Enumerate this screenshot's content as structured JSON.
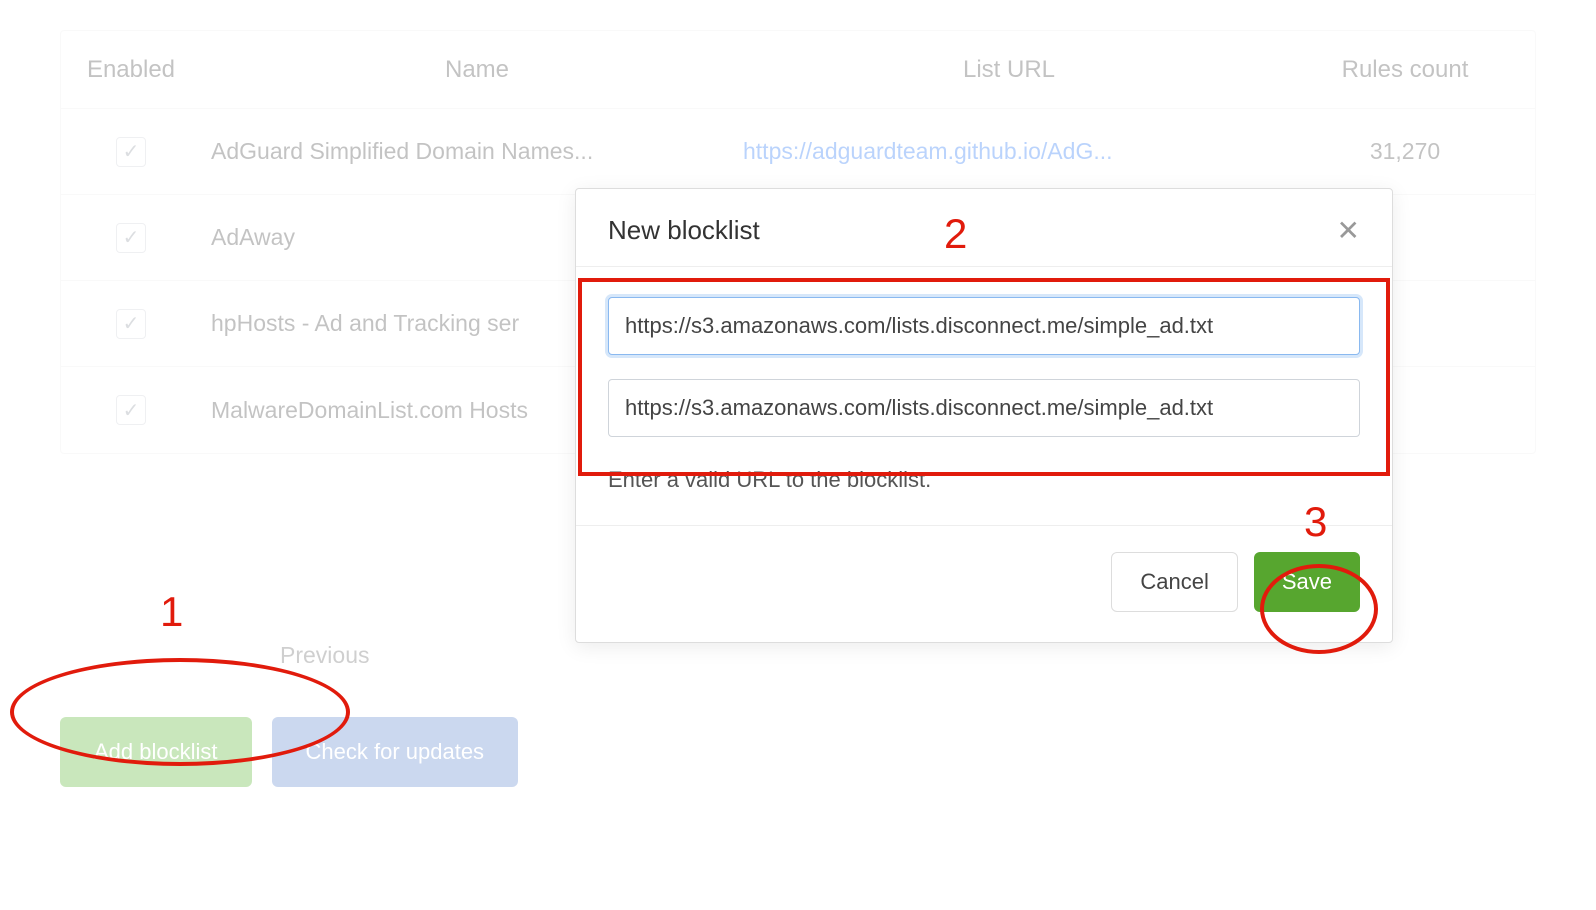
{
  "table": {
    "headers": {
      "enabled": "Enabled",
      "name": "Name",
      "url": "List URL",
      "rules": "Rules count"
    },
    "rows": [
      {
        "name": "AdGuard Simplified Domain Names...",
        "url": "https://adguardteam.github.io/AdG...",
        "rules": "31,270"
      },
      {
        "name": "AdAway",
        "url": "",
        "rules": ""
      },
      {
        "name": "hpHosts - Ad and Tracking ser",
        "url": "",
        "rules": ""
      },
      {
        "name": "MalwareDomainList.com Hosts",
        "url": "",
        "rules": ""
      }
    ]
  },
  "pager": {
    "previous": "Previous"
  },
  "actions": {
    "add_blocklist": "Add blocklist",
    "check_updates": "Check for updates"
  },
  "modal": {
    "title": "New blocklist",
    "name_value": "https://s3.amazonaws.com/lists.disconnect.me/simple_ad.txt",
    "url_value": "https://s3.amazonaws.com/lists.disconnect.me/simple_ad.txt",
    "helper": "Enter a valid URL to the blocklist.",
    "cancel": "Cancel",
    "save": "Save"
  },
  "annotations": {
    "one": "1",
    "two": "2",
    "three": "3"
  }
}
